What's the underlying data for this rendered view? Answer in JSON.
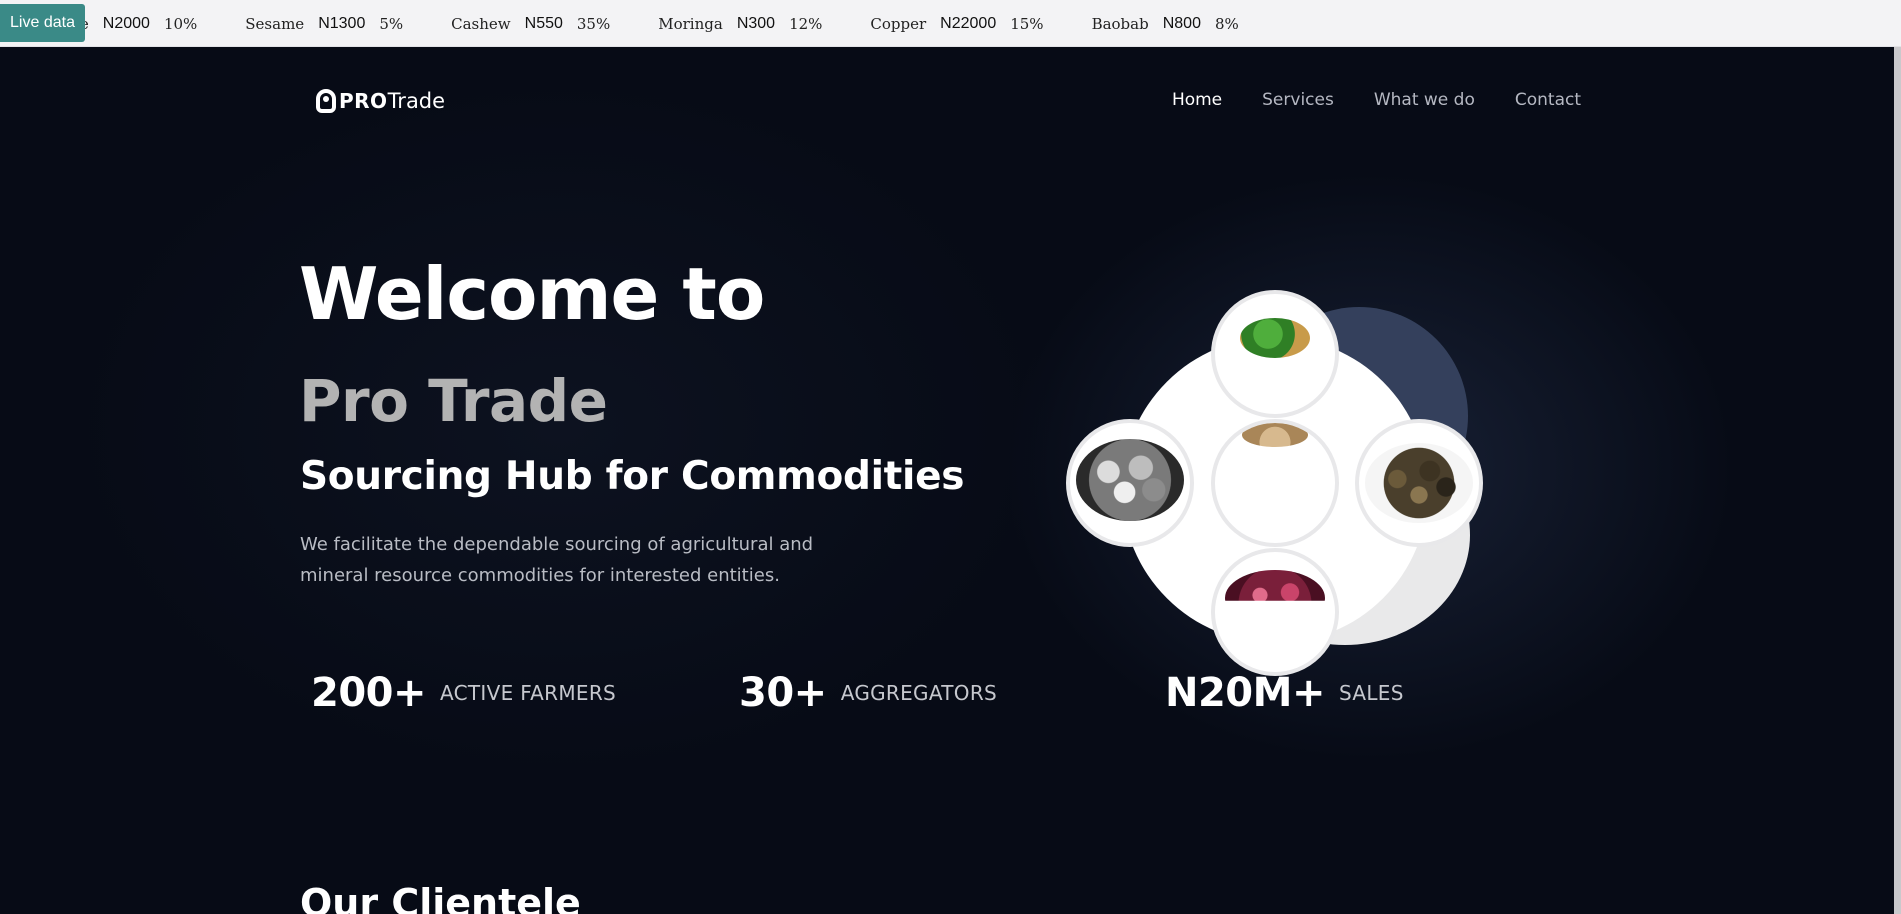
{
  "ticker": {
    "badge": "Live data",
    "items": [
      {
        "name": "ze",
        "price": "N2000",
        "change": "10%"
      },
      {
        "name": "Sesame",
        "price": "N1300",
        "change": "5%"
      },
      {
        "name": "Cashew",
        "price": "N550",
        "change": "35%"
      },
      {
        "name": "Moringa",
        "price": "N300",
        "change": "12%"
      },
      {
        "name": "Copper",
        "price": "N22000",
        "change": "15%"
      },
      {
        "name": "Baobab",
        "price": "N800",
        "change": "8%"
      }
    ]
  },
  "nav": {
    "logo_bold": "PRO",
    "logo_light": "Trade",
    "links": [
      {
        "label": "Home",
        "active": true
      },
      {
        "label": "Services",
        "active": false
      },
      {
        "label": "What we do",
        "active": false
      },
      {
        "label": "Contact",
        "active": false
      }
    ]
  },
  "hero": {
    "welcome": "Welcome to",
    "brand": "Pro Trade",
    "subtitle": "Sourcing Hub for Commodities",
    "description": "We facilitate the dependable sourcing of agricultural and mineral resource commodities for interested entities."
  },
  "stats": [
    {
      "value": "200+",
      "label": "ACTIVE FARMERS"
    },
    {
      "value": "30+",
      "label": "AGGREGATORS"
    },
    {
      "value": "N20M+",
      "label": "SALES"
    }
  ],
  "clientele": {
    "title": "Our Clientele"
  },
  "colors": {
    "background": "#070b16",
    "accent_badge": "#3a8a87",
    "brand_grey": "#b3b3b3",
    "navy_circle": "#34405c"
  },
  "graphic": {
    "icons": [
      "leafy-greens-icon",
      "grain-icon",
      "mineral-rocks-icon",
      "dried-herbs-icon",
      "hibiscus-icon"
    ]
  }
}
